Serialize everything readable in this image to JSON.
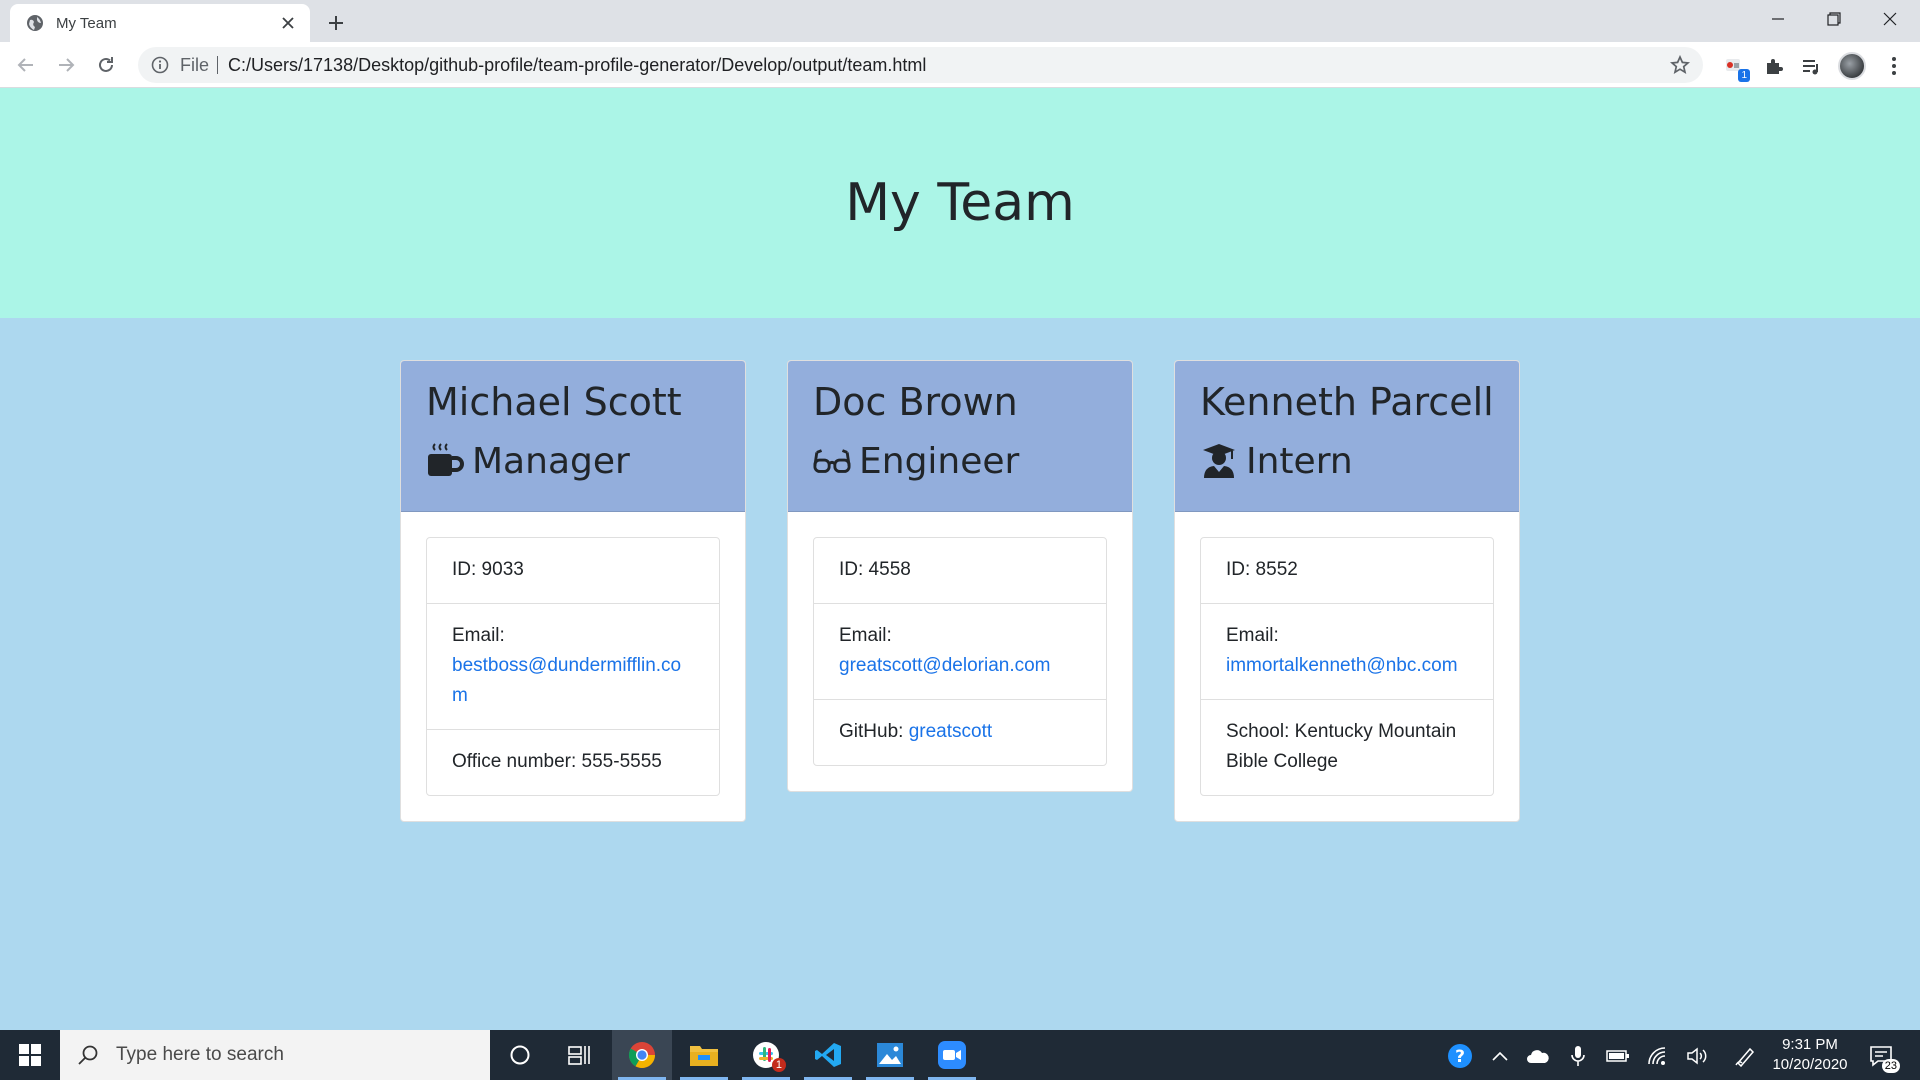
{
  "browser": {
    "tab_title": "My Team",
    "address_scheme": "File",
    "address_url": "C:/Users/17138/Desktop/github-profile/team-profile-generator/Develop/output/team.html",
    "extension_badge": "1"
  },
  "page": {
    "title": "My Team"
  },
  "team": [
    {
      "name": "Michael Scott",
      "role": "Manager",
      "role_icon": "mug-icon",
      "id_label": "ID: 9033",
      "email_label": "Email:",
      "email": "bestboss@dundermifflin.com",
      "extra_label": "Office number: 555-5555",
      "extra_link": ""
    },
    {
      "name": "Doc Brown",
      "role": "Engineer",
      "role_icon": "glasses-icon",
      "id_label": "ID: 4558",
      "email_label": "Email:",
      "email": "greatscott@delorian.com",
      "extra_label": "GitHub: ",
      "extra_link": "greatscott"
    },
    {
      "name": "Kenneth Parcell",
      "role": "Intern",
      "role_icon": "graduate-icon",
      "id_label": "ID: 8552",
      "email_label": "Email:",
      "email": "immortalkenneth@nbc.com",
      "extra_label": "School: Kentucky Mountain Bible College",
      "extra_link": ""
    }
  ],
  "taskbar": {
    "search_placeholder": "Type here to search",
    "time": "9:31 PM",
    "date": "10/20/2020",
    "notification_count": "23",
    "slack_badge": "1"
  },
  "colors": {
    "header_bg": "#abf5e7",
    "page_bg": "#add8ef",
    "card_header_bg": "#93aedc",
    "link": "#1a73e8"
  }
}
